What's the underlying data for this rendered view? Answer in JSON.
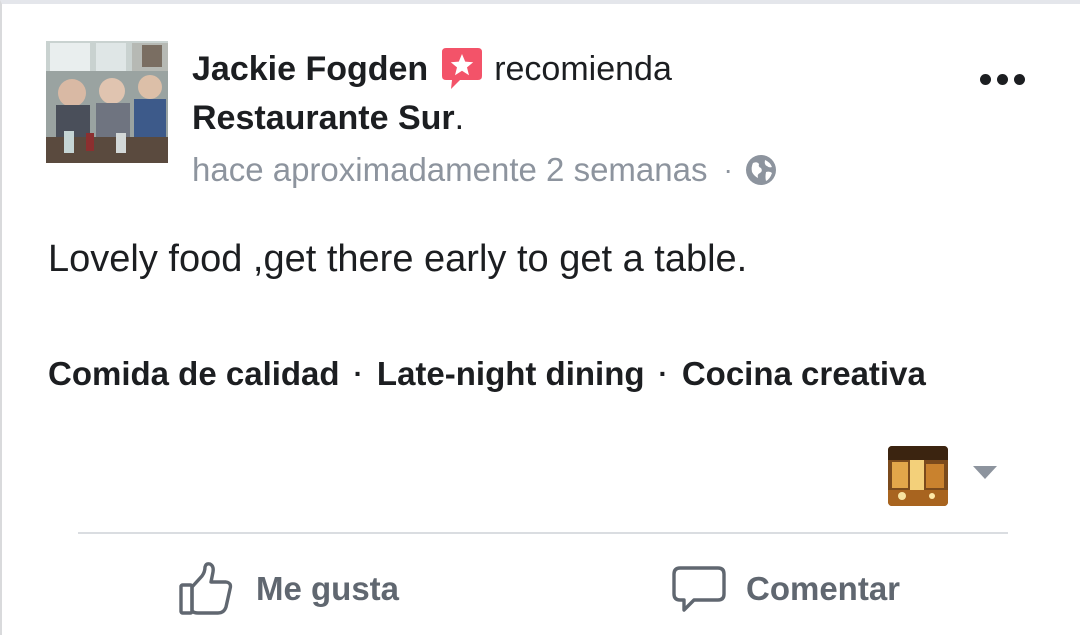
{
  "post": {
    "author": "Jackie Fogden",
    "verb": "recomienda",
    "place": "Restaurante Sur",
    "place_punct": ".",
    "timestamp": "hace aproximadamente 2 semanas",
    "meta_separator": "·",
    "privacy_icon": "globe-icon",
    "recommend_icon": "recommend-star-icon",
    "text": "Lovely food ,get there early to get a table.",
    "tags": [
      "Comida de calidad",
      "Late-night dining",
      "Cocina creativa"
    ],
    "tag_separator": "·"
  },
  "actions": {
    "like": {
      "label": "Me gusta",
      "icon": "thumbs-up-icon"
    },
    "comment": {
      "label": "Comentar",
      "icon": "comment-icon"
    }
  },
  "menu": {
    "icon": "more-options-icon"
  },
  "audience": {
    "icon": "chevron-down-icon"
  },
  "colors": {
    "recommend_accent": "#f35369",
    "text_primary": "#1c1e21",
    "text_secondary": "#8d949e",
    "action_text": "#606770",
    "divider": "#dadde1"
  }
}
